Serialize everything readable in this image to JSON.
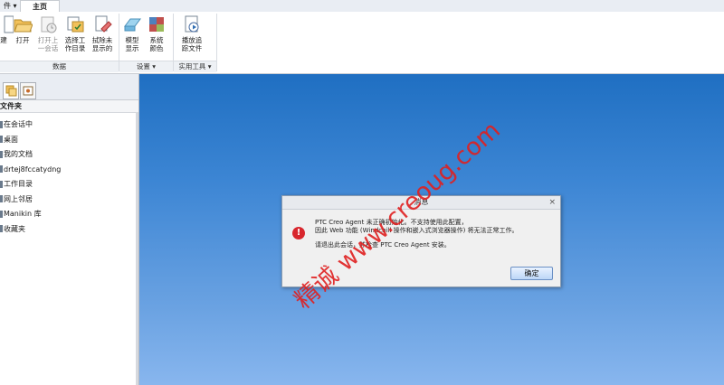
{
  "ribbon": {
    "tabs": [
      {
        "label": "件 ▾"
      },
      {
        "label": "主页"
      }
    ],
    "buttons": [
      {
        "label": "建",
        "icon": "new-icon"
      },
      {
        "label": "打开",
        "icon": "open-folder-icon"
      },
      {
        "label": "打开上\n一会话",
        "icon": "open-last-session-icon"
      },
      {
        "label": "选择工\n作目录",
        "icon": "select-working-directory-icon"
      },
      {
        "label": "拭除未\n显示的",
        "icon": "erase-not-displayed-icon"
      },
      {
        "label": "模型\n显示",
        "icon": "model-display-icon"
      },
      {
        "label": "系统\n颜色",
        "icon": "system-colors-icon"
      },
      {
        "label": "播放追\n踪文件",
        "icon": "play-trail-file-icon"
      }
    ],
    "groups": [
      {
        "label": "数据"
      },
      {
        "label": "设置 ▾"
      },
      {
        "label": "实用工具 ▾"
      }
    ]
  },
  "navigator": {
    "header": "文件夹",
    "items": [
      {
        "label": "在会话中"
      },
      {
        "label": "桌面"
      },
      {
        "label": "我的文档"
      },
      {
        "label": "drtej8fccatydng"
      },
      {
        "label": "工作目录"
      },
      {
        "label": "网上邻居"
      },
      {
        "label": "Manikin 库"
      },
      {
        "label": "收藏夹"
      }
    ]
  },
  "dialog": {
    "title": "消息",
    "close": "×",
    "line1": "PTC Creo Agent 未正确初始化。不支持使用此配置，",
    "line2": "因此 Web 功能 (Windchill 操作和嵌入式浏览器操作) 将无法正常工作。",
    "line3": "请退出此会话，并检查 PTC Creo Agent 安装。",
    "ok_label": "确定",
    "icon": "error-icon"
  },
  "watermark": {
    "text": "精诚 www.creoug.com"
  },
  "colors": {
    "graphics_top": "#1f6fc2",
    "graphics_bottom": "#88b6ee",
    "error_red": "#d8262d",
    "watermark_red": "#e02020"
  }
}
